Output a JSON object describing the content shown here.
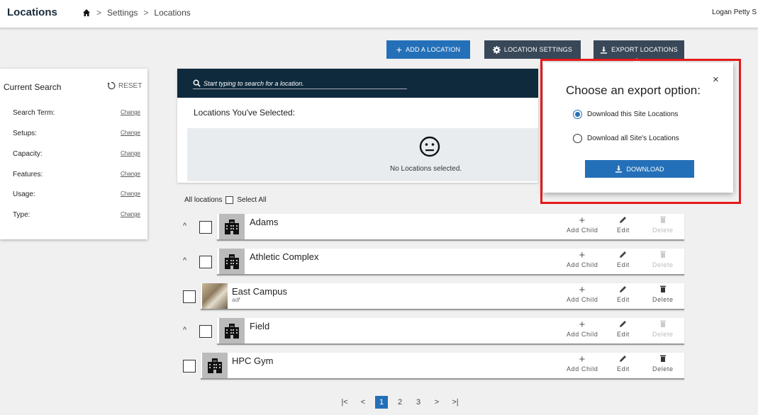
{
  "header": {
    "title": "Locations",
    "breadcrumb": [
      "Settings",
      "Locations"
    ],
    "user": "Logan Petty S"
  },
  "actions": {
    "add": "ADD A LOCATION",
    "settings": "LOCATION SETTINGS",
    "export": "EXPORT LOCATIONS"
  },
  "filters": {
    "title": "Current Search",
    "reset": "RESET",
    "change": "Change",
    "rows": [
      "Search Term:",
      "Setups:",
      "Capacity:",
      "Features:",
      "Usage:",
      "Type:"
    ]
  },
  "search": {
    "placeholder": "Start typing to search for a location.",
    "selected_title": "Locations You've Selected:",
    "empty_text": "No Locations selected."
  },
  "list": {
    "all_label": "All locations",
    "select_all": "Select All",
    "add_child": "Add Child",
    "edit": "Edit",
    "delete": "Delete",
    "rows": [
      {
        "name": "Adams",
        "sub": ""
      },
      {
        "name": "Athletic Complex",
        "sub": ""
      },
      {
        "name": "East Campus",
        "sub": "adf"
      },
      {
        "name": "Field",
        "sub": ""
      },
      {
        "name": "HPC Gym",
        "sub": ""
      }
    ]
  },
  "pagination": {
    "first": "|<",
    "prev": "<",
    "pages": [
      "1",
      "2",
      "3"
    ],
    "current": "1",
    "next": ">",
    "last": ">|"
  },
  "export_popup": {
    "title": "Choose an export option:",
    "close": "×",
    "options": [
      "Download this Site Locations",
      "Download all Site's Locations"
    ],
    "selected_option": "Download this Site Locations",
    "download": "DOWNLOAD"
  },
  "colors": {
    "primary": "#2470b8",
    "dark_button": "#384858",
    "search_bar": "#0f2a3d",
    "highlight": "#e41a1a"
  }
}
